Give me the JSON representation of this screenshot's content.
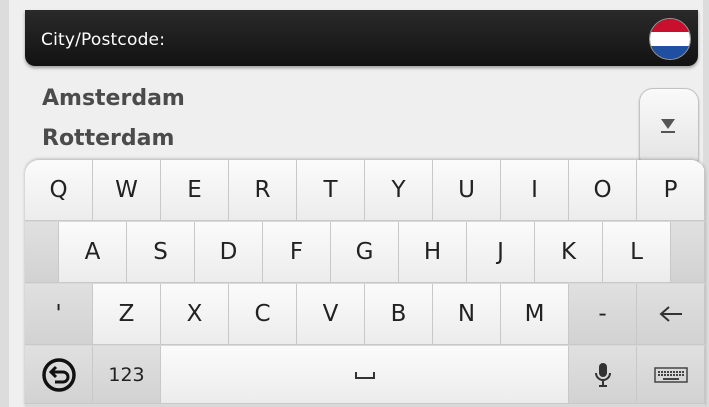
{
  "header": {
    "label": "City/Postcode:",
    "flag_icon": "netherlands-flag-icon",
    "flag_colors": [
      "#c8102e",
      "#ffffff",
      "#1e4fa0"
    ]
  },
  "results": {
    "items": [
      "Amsterdam",
      "Rotterdam"
    ]
  },
  "scroll": {
    "icon": "scroll-down-icon"
  },
  "keyboard": {
    "row1": [
      "Q",
      "W",
      "E",
      "R",
      "T",
      "Y",
      "U",
      "I",
      "O",
      "P"
    ],
    "row2": [
      "A",
      "S",
      "D",
      "F",
      "G",
      "H",
      "J",
      "K",
      "L"
    ],
    "row3": [
      "'",
      "Z",
      "X",
      "C",
      "V",
      "B",
      "N",
      "M",
      "-"
    ],
    "backspace_icon": "backspace-arrow-icon",
    "numbers_label": "123",
    "back_icon": "back-icon",
    "space_icon": "space-bar-icon",
    "mic_icon": "microphone-icon",
    "hide_keyboard_icon": "keyboard-icon"
  }
}
